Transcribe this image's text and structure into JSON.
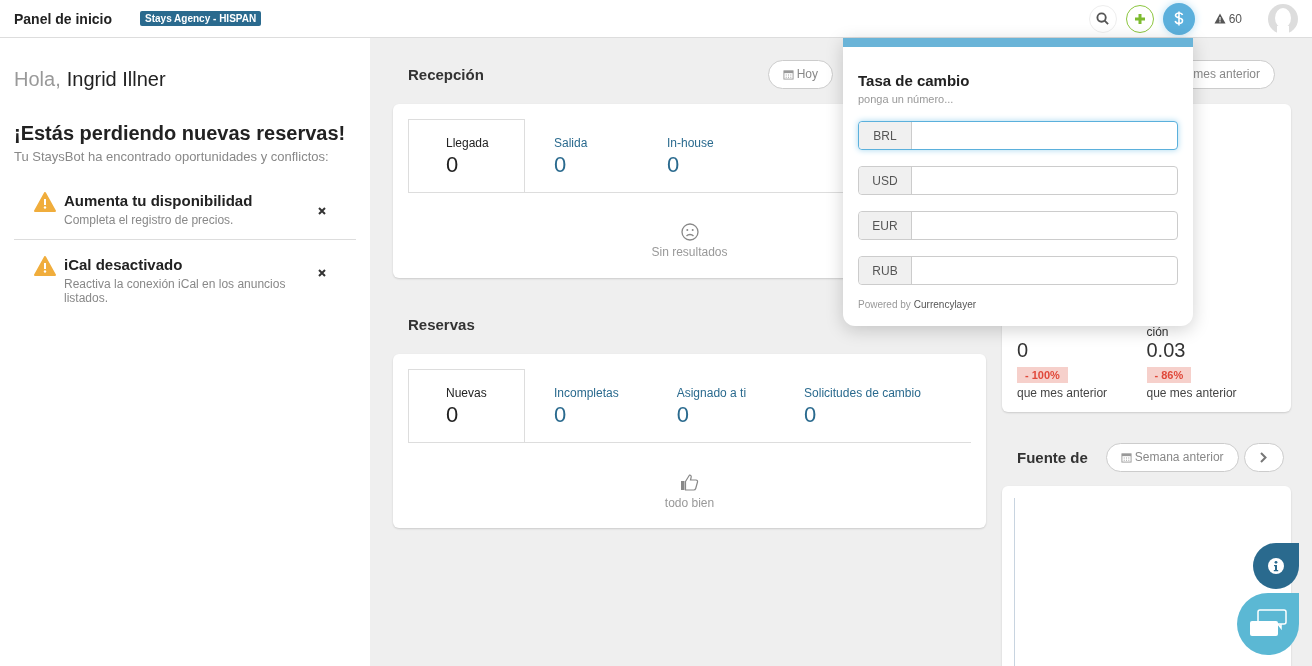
{
  "header": {
    "title": "Panel de inicio",
    "agency_badge": "Stays Agency - HISPAN",
    "alerts_count": "60"
  },
  "sidebar": {
    "greeting": "Hola,",
    "user_name": "Ingrid Illner",
    "heading": "¡Estás perdiendo nuevas reservas!",
    "subheading": "Tu StaysBot ha encontrado oportunidades y conflictos:",
    "alerts": [
      {
        "title": "Aumenta tu disponibilidad",
        "description": "Completa el registro de precios."
      },
      {
        "title": "iCal desactivado",
        "description": "Reactiva la conexión iCal en los anuncios listados."
      }
    ]
  },
  "reception": {
    "title": "Recepción",
    "period_button": "Hoy",
    "tabs": [
      {
        "label": "Llegada",
        "count": "0",
        "selected": true
      },
      {
        "label": "Salida",
        "count": "0",
        "selected": false
      },
      {
        "label": "In-house",
        "count": "0",
        "selected": false
      }
    ],
    "empty_text": "Sin resultados"
  },
  "reservations": {
    "title": "Reservas",
    "tabs": [
      {
        "label": "Nuevas",
        "count": "0",
        "selected": true
      },
      {
        "label": "Incompletas",
        "count": "0",
        "selected": false
      },
      {
        "label": "Asignado a ti",
        "count": "0",
        "selected": false
      },
      {
        "label": "Solicitudes de cambio",
        "count": "0",
        "selected": false
      }
    ],
    "empty_text": "todo bien"
  },
  "stats": {
    "period_button": "mes anterior",
    "metrics": [
      {
        "value": "0",
        "change": "- 100%",
        "comparison": "que mes anterior"
      },
      {
        "label": "ción",
        "value": "0.03",
        "change": "- 86%",
        "comparison": "que mes anterior"
      }
    ]
  },
  "source": {
    "title": "Fuente de",
    "period_button": "Semana anterior"
  },
  "currency_popup": {
    "title": "Tasa de cambio",
    "subtitle": "ponga un número...",
    "fields": [
      {
        "currency": "BRL",
        "focused": true
      },
      {
        "currency": "USD",
        "focused": false
      },
      {
        "currency": "EUR",
        "focused": false
      },
      {
        "currency": "RUB",
        "focused": false
      }
    ],
    "powered_by": "Powered by",
    "provider": "Currencylayer"
  }
}
